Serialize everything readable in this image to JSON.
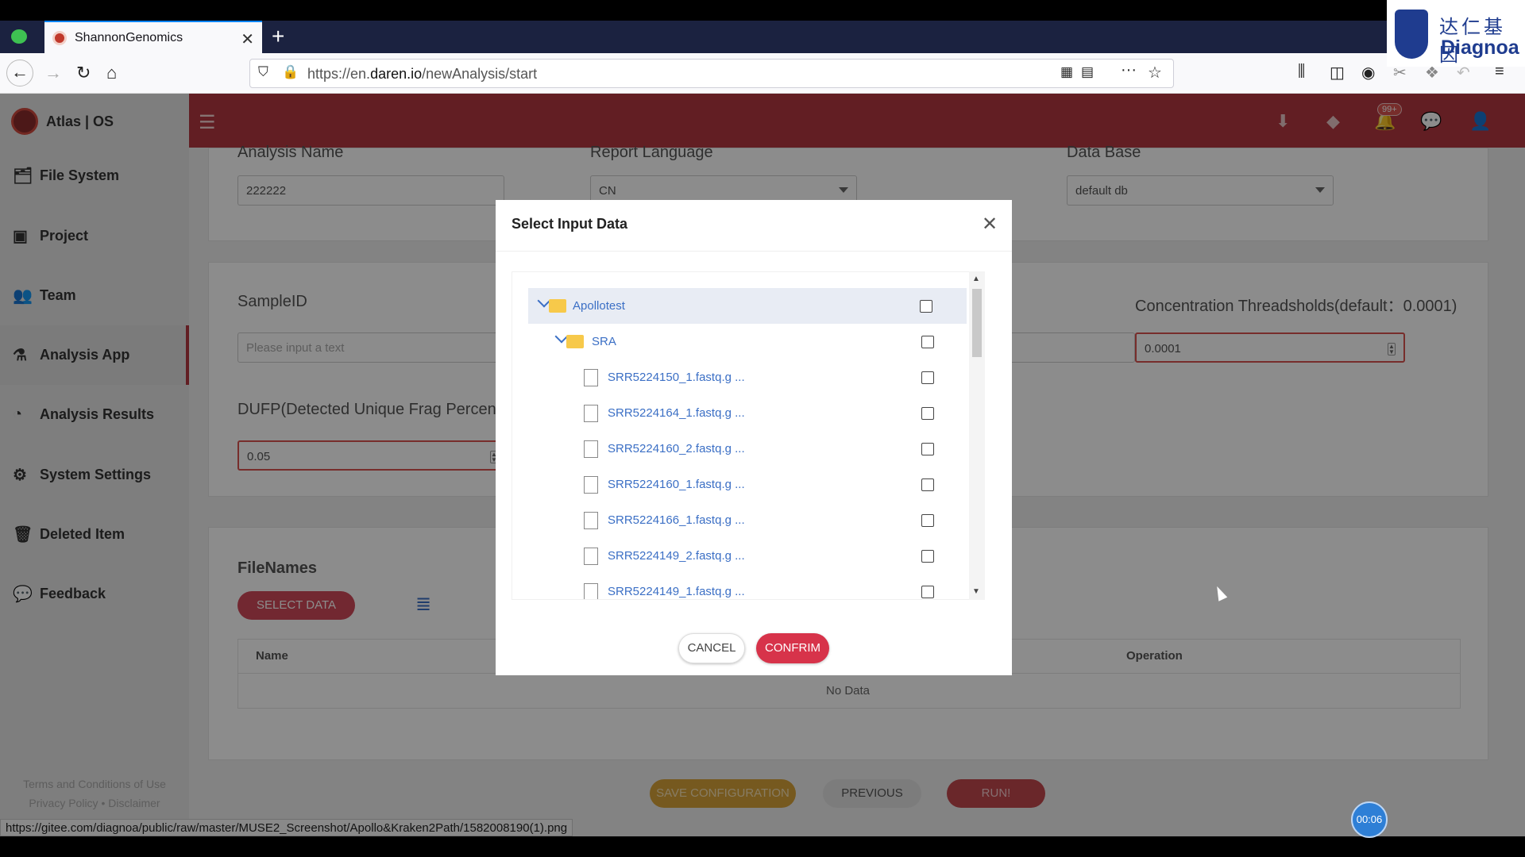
{
  "browser": {
    "tab_title": "ShannonGenomics",
    "url_prefix": "https://en.",
    "url_domain": "daren.io",
    "url_path": "/newAnalysis/start",
    "status_url": "https://gitee.com/diagnoa/public/raw/master/MUSE2_Screenshot/Apollo&Kraken2Path/1582008190(1).png"
  },
  "brand": {
    "cn": "达仁基因",
    "en": "Diagnoa"
  },
  "app": {
    "logo": "Atlas | OS",
    "sidebar": [
      {
        "label": "File System",
        "icon": "🗂"
      },
      {
        "label": "Project",
        "icon": "▣"
      },
      {
        "label": "Team",
        "icon": "👥"
      },
      {
        "label": "Analysis App",
        "icon": "⚗"
      },
      {
        "label": "Analysis Results",
        "icon": "◔"
      },
      {
        "label": "System Settings",
        "icon": "⚙"
      },
      {
        "label": "Deleted Item",
        "icon": "🗑"
      },
      {
        "label": "Feedback",
        "icon": "💬"
      }
    ],
    "footer_line1": "Terms and Conditions of Use",
    "footer_line2": "Privacy Policy • Disclaimer",
    "notif_badge": "99+"
  },
  "form": {
    "analysis_name_label": "Analysis Name",
    "analysis_name_value": "222222",
    "report_language_label": "Report Language",
    "report_language_value": "CN",
    "database_label": "Data Base",
    "database_value": "default db",
    "sampleid_label": "SampleID",
    "sampleid_placeholder": "Please input a text",
    "concentration_label": "Concentration Threadsholds(default：0.0001)",
    "concentration_value": "0.0001",
    "dufp_label": "DUFP(Detected Unique Frag Percen",
    "dufp_value": "0.05",
    "filenames_label": "FileNames",
    "select_data_button": "SELECT DATA",
    "col_name": "Name",
    "col_operation": "Operation",
    "no_data": "No Data"
  },
  "footer_buttons": {
    "save": "SAVE CONFIGURATION",
    "previous": "PREVIOUS",
    "run": "RUN!"
  },
  "timer": "00:06",
  "modal": {
    "title": "Select Input Data",
    "cancel": "CANCEL",
    "confirm": "CONFRIM",
    "tree": [
      {
        "label": "Apollotest",
        "type": "folder",
        "level": 0
      },
      {
        "label": "SRA",
        "type": "folder",
        "level": 1
      },
      {
        "label": "SRR5224150_1.fastq.g ...",
        "type": "file",
        "level": 2
      },
      {
        "label": "SRR5224164_1.fastq.g ...",
        "type": "file",
        "level": 2
      },
      {
        "label": "SRR5224160_2.fastq.g ...",
        "type": "file",
        "level": 2
      },
      {
        "label": "SRR5224160_1.fastq.g ...",
        "type": "file",
        "level": 2
      },
      {
        "label": "SRR5224166_1.fastq.g ...",
        "type": "file",
        "level": 2
      },
      {
        "label": "SRR5224149_2.fastq.g ...",
        "type": "file",
        "level": 2
      },
      {
        "label": "SRR5224149_1.fastq.g ...",
        "type": "file",
        "level": 2
      }
    ]
  }
}
